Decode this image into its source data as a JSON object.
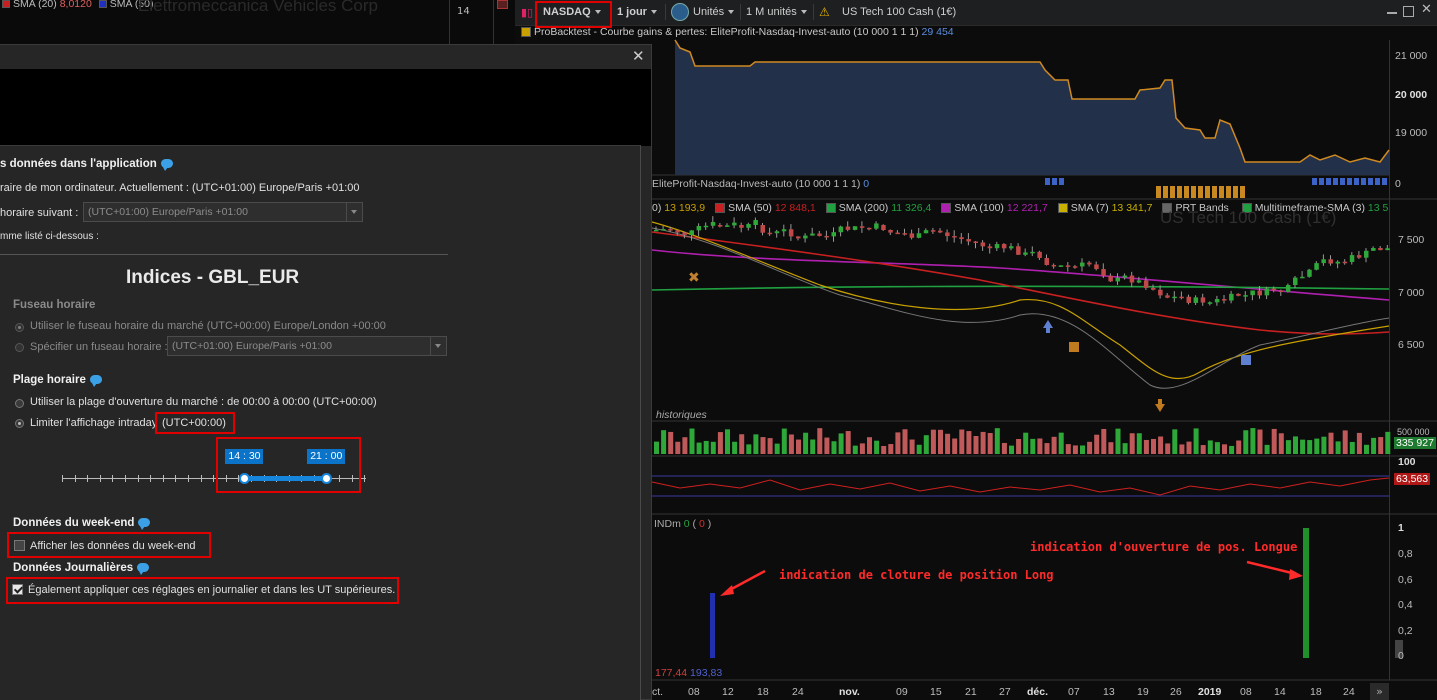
{
  "top_left": {
    "sma20_label": "SMA (20)",
    "sma20_value": "8,0120",
    "sma50_label": "SMA (50)",
    "bg_title": "Elettromeccanica Vehicles Corp",
    "num": "14"
  },
  "toolbar": {
    "instrument": "NASDAQ",
    "period": "1 jour",
    "units": "Unités",
    "count": "1 M unités",
    "warning": "⚠",
    "product": "US Tech 100 Cash (1€)"
  },
  "backtest_panel": {
    "legend_label": "ProBacktest - Courbe gains & pertes: EliteProfit-Nasdaq-Invest-auto (10 000 1 1 1)",
    "legend_value": "29 454",
    "y_ticks": [
      "21 000",
      "20 000",
      "19 000"
    ],
    "sub_legend_label": "EliteProfit-Nasdaq-Invest-auto (10 000 1 1 1)",
    "sub_legend_value": "0",
    "sub_right": "0"
  },
  "price_panel": {
    "legend": [
      {
        "text": "0)",
        "value": "13 193,9",
        "color": "#c8a000"
      },
      {
        "text": "SMA (50)",
        "value": "12 848,1",
        "color": "#c82020"
      },
      {
        "text": "SMA (200)",
        "value": "11 326,4",
        "color": "#20a040"
      },
      {
        "text": "SMA (100)",
        "value": "12 221,7",
        "color": "#b020b0"
      },
      {
        "text": "SMA (7)",
        "value": "13 341,7",
        "color": "#c8b000"
      },
      {
        "text": "PRT Bands",
        "value": "",
        "color": "#666666"
      },
      {
        "text": "Multitimeframe-SMA (3)",
        "value": "13 5",
        "color": "#20a040"
      }
    ],
    "watermark": "US Tech 100 Cash (1€)",
    "y_ticks": [
      "7 500",
      "7 000",
      "6 500"
    ],
    "historiques": "historiques"
  },
  "volume_panel": {
    "value": "335 927",
    "top": "500 000"
  },
  "rsi_panel": {
    "value": "63,563",
    "top": "100"
  },
  "ind_panel": {
    "legend": "INDm",
    "legend_v1": "0",
    "legend_v2": "0",
    "y_ticks": [
      "1",
      "0,8",
      "0,6",
      "0,4",
      "0,2",
      "0"
    ],
    "bottom_left": "177,44",
    "bottom_right": "193,83",
    "annot_close": "indication de cloture de position Long",
    "annot_open": "indication d'ouverture de pos. Longue"
  },
  "x_axis": [
    "ct.",
    "08",
    "12",
    "18",
    "24",
    "nov.",
    "09",
    "15",
    "21",
    "27",
    "déc.",
    "07",
    "13",
    "19",
    "26",
    "2019",
    "08",
    "14",
    "18",
    "24"
  ],
  "dialog": {
    "close": "✕",
    "section_app_title": "s données dans l'application",
    "line_computer": "raire de mon ordinateur. Actuellement : (UTC+01:00) Europe/Paris +01:00",
    "line_following": "horaire suivant :",
    "select_following": "(UTC+01:00) Europe/Paris +01:00",
    "line_listed": "mme listé ci-dessous :",
    "index_title": "Indices - GBL_EUR",
    "tz_title": "Fuseau horaire",
    "tz_market": "Utiliser le fuseau horaire du marché (UTC+00:00) Europe/London +00:00",
    "tz_specify": "Spécifier un fuseau horaire :",
    "tz_select": "(UTC+01:00) Europe/Paris +01:00",
    "range_title": "Plage horaire",
    "range_full": "Utiliser la plage d'ouverture du marché : de 00:00 à 00:00  (UTC+00:00)",
    "range_limit": "Limiter l'affichage intraday",
    "range_utc": "(UTC+00:00)",
    "slider_start": "14 : 30",
    "slider_end": "21 : 00",
    "slider_start_frac": 0.6042,
    "slider_end_frac": 0.875,
    "weekend_title": "Données du week-end",
    "weekend_show": "Afficher les données du week-end",
    "daily_title": "Données Journalières",
    "daily_apply": "Également appliquer ces réglages en journalier et dans les UT supérieures."
  },
  "colors": {
    "accent": "#0b74c8",
    "highlight": "#e00000",
    "annotation": "#ff2a2a"
  }
}
